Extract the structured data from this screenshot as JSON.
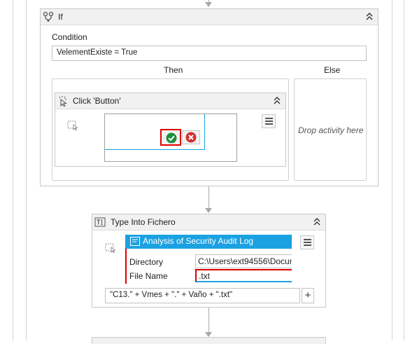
{
  "if_activity": {
    "title": "If",
    "condition_label": "Condition",
    "condition_value": "VelementExiste = True",
    "then_label": "Then",
    "else_label": "Else",
    "else_placeholder": "Drop activity here"
  },
  "click_activity": {
    "title": "Click 'Button'"
  },
  "type_into_activity": {
    "title": "Type Into Fichero",
    "window_title": "Analysis of Security Audit Log",
    "fields": [
      {
        "label": "Directory",
        "value": "C:\\Users\\ext94556\\Docum"
      },
      {
        "label": "File Name",
        "value": ".txt"
      }
    ],
    "text_expression": "\"C13.\"  +  Vmes + \".\" + Vaño + \".txt\"",
    "add_button_label": "+"
  },
  "colors": {
    "accent_blue": "#1ba1e2",
    "header_bg": "#f1f1f1",
    "ok_green": "#1e8e3e",
    "cancel_red": "#d32f2f",
    "selection_red": "#e00000"
  }
}
